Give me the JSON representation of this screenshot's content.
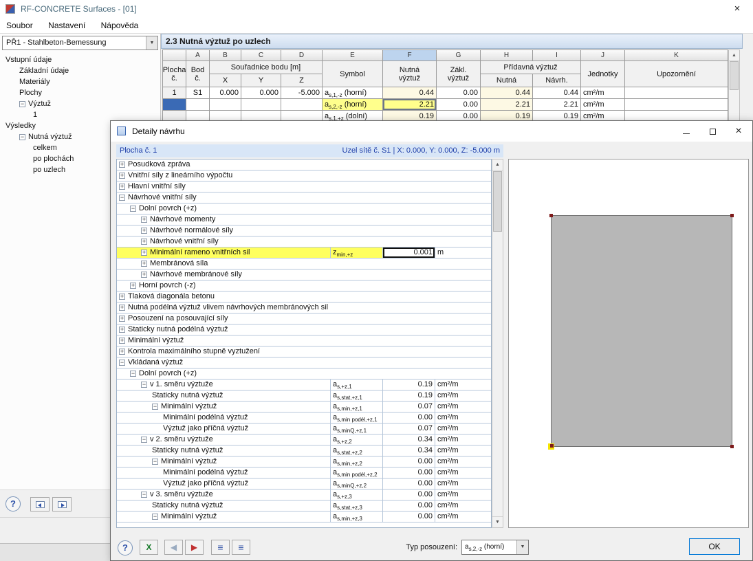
{
  "window": {
    "title": "RF-CONCRETE Surfaces - [01]"
  },
  "icons": {
    "close": "×",
    "help": "?",
    "excel": "X",
    "prev": "◀",
    "next": "▶",
    "list1": "≡",
    "list2": "≡",
    "up": "▲",
    "down": "▼",
    "dropdown": "▼"
  },
  "menu": {
    "items": [
      "Soubor",
      "Nastavení",
      "Nápověda"
    ]
  },
  "navigator": {
    "case_name": "PŘ1 - Stahlbeton-Bemessung",
    "items": [
      {
        "label": "Vstupní údaje",
        "indent": 0,
        "box": ""
      },
      {
        "label": "Základní údaje",
        "indent": 1,
        "box": ""
      },
      {
        "label": "Materiály",
        "indent": 1,
        "box": ""
      },
      {
        "label": "Plochy",
        "indent": 1,
        "box": ""
      },
      {
        "label": "Výztuž",
        "indent": 1,
        "box": "-"
      },
      {
        "label": "1",
        "indent": 2,
        "box": ""
      },
      {
        "label": "Výsledky",
        "indent": 0,
        "box": ""
      },
      {
        "label": "Nutná výztuž",
        "indent": 1,
        "box": "-"
      },
      {
        "label": "celkem",
        "indent": 2,
        "box": ""
      },
      {
        "label": "po plochách",
        "indent": 2,
        "box": ""
      },
      {
        "label": "po uzlech",
        "indent": 2,
        "box": ""
      }
    ]
  },
  "main": {
    "section_title": "2.3 Nutná výztuž po uzlech",
    "table": {
      "letters": [
        "",
        "A",
        "B",
        "C",
        "D",
        "E",
        "F",
        "G",
        "H",
        "I",
        "J",
        "K"
      ],
      "selected_letter": "F",
      "headers": {
        "plocha": "Plocha\nč.",
        "bod": "Bod\nč.",
        "coords": "Souřadnice bodu [m]",
        "x": "X",
        "y": "Y",
        "z": "Z",
        "symbol": "Symbol",
        "nutna": "Nutná\nvýztuž",
        "zakl": "Zákl.\nvýztuž",
        "pridavna": "Přídavná výztuž",
        "prid_nutna": "Nutná",
        "prid_navrh": "Návrh.",
        "jednotky": "Jednotky",
        "upozorneni": "Upozornění"
      },
      "rows": [
        {
          "plocha": "1",
          "bod": "S1",
          "x": "0.000",
          "y": "0.000",
          "z": "-5.000",
          "sym": {
            "b": "a",
            "s": "s,1,-z",
            "t": " (horní)"
          },
          "f": "0.44",
          "g": "0.00",
          "h": "0.44",
          "i": "0.44",
          "unit": "cm²/m",
          "note": "",
          "hl": false,
          "sel": false
        },
        {
          "plocha": "",
          "bod": "",
          "x": "",
          "y": "",
          "z": "",
          "sym": {
            "b": "a",
            "s": "s,2,-z",
            "t": " (horní)"
          },
          "f": "2.21",
          "g": "0.00",
          "h": "2.21",
          "i": "2.21",
          "unit": "cm²/m",
          "note": "",
          "hl": true,
          "sel": true
        },
        {
          "plocha": "",
          "bod": "",
          "x": "",
          "y": "",
          "z": "",
          "sym": {
            "b": "a",
            "s": "s,1,+z",
            "t": " (dolní)"
          },
          "f": "0.19",
          "g": "0.00",
          "h": "0.19",
          "i": "0.19",
          "unit": "cm²/m",
          "note": "",
          "hl": false,
          "sel": false
        }
      ]
    }
  },
  "dialog": {
    "title": "Detaily návrhu",
    "surface_label": "Plocha č. 1",
    "node_label": "Uzel sítě č. S1  |  X: 0.000, Y: 0.000, Z: -5.000 m",
    "tree": [
      {
        "label": "Posudková zpráva",
        "indent": 0,
        "box": "+"
      },
      {
        "label": "Vnitřní síly z lineárního výpočtu",
        "indent": 0,
        "box": "+"
      },
      {
        "label": "Hlavní vnitřní síly",
        "indent": 0,
        "box": "+"
      },
      {
        "label": "Návrhové vnitřní síly",
        "indent": 0,
        "box": "-"
      },
      {
        "label": "Dolní povrch (+z)",
        "indent": 1,
        "box": "-"
      },
      {
        "label": "Návrhové momenty",
        "indent": 2,
        "box": "+"
      },
      {
        "label": "Návrhové normálové síly",
        "indent": 2,
        "box": "+"
      },
      {
        "label": "Návrhové vnitřní síly",
        "indent": 2,
        "box": "+"
      },
      {
        "label": "Minimální rameno vnitřních sil",
        "indent": 2,
        "box": "+",
        "hl": true,
        "sym": {
          "b": "z",
          "s": "min,+z"
        },
        "val": "0.001",
        "unit": "m",
        "valbox": true
      },
      {
        "label": "Membránová síla",
        "indent": 2,
        "box": "+"
      },
      {
        "label": "Návrhové membránové síly",
        "indent": 2,
        "box": "+"
      },
      {
        "label": "Horní povrch (-z)",
        "indent": 1,
        "box": "+"
      },
      {
        "label": "Tlaková diagonála betonu",
        "indent": 0,
        "box": "+"
      },
      {
        "label": "Nutná podélná výztuž vlivem návrhových membránových sil",
        "indent": 0,
        "box": "+"
      },
      {
        "label": "Posouzení na posouvající síly",
        "indent": 0,
        "box": "+"
      },
      {
        "label": "Staticky nutná podélná výztuž",
        "indent": 0,
        "box": "+"
      },
      {
        "label": "Minimální výztuž",
        "indent": 0,
        "box": "+"
      },
      {
        "label": "Kontrola maximálního stupně vyztužení",
        "indent": 0,
        "box": "+"
      },
      {
        "label": "Vkládaná výztuž",
        "indent": 0,
        "box": "-"
      },
      {
        "label": "Dolní povrch (+z)",
        "indent": 1,
        "box": "-"
      },
      {
        "label": "v 1. směru výztuže",
        "indent": 2,
        "box": "-",
        "sym": {
          "b": "a",
          "s": "s,+z,1"
        },
        "val": "0.19",
        "unit": "cm²/m"
      },
      {
        "label": "Staticky nutná výztuž",
        "indent": 3,
        "box": "",
        "sym": {
          "b": "a",
          "s": "s,stat,+z,1"
        },
        "val": "0.19",
        "unit": "cm²/m"
      },
      {
        "label": "Minimální výztuž",
        "indent": 3,
        "box": "-",
        "sym": {
          "b": "a",
          "s": "s,min,+z,1"
        },
        "val": "0.07",
        "unit": "cm²/m"
      },
      {
        "label": "Minimální podélná výztuž",
        "indent": 4,
        "box": "",
        "sym": {
          "b": "a",
          "s": "s,min podél,+z,1"
        },
        "val": "0.00",
        "unit": "cm²/m"
      },
      {
        "label": "Výztuž jako příčná výztuž",
        "indent": 4,
        "box": "",
        "sym": {
          "b": "a",
          "s": "s,minQ,+z,1"
        },
        "val": "0.07",
        "unit": "cm²/m"
      },
      {
        "label": "v 2. směru výztuže",
        "indent": 2,
        "box": "-",
        "sym": {
          "b": "a",
          "s": "s,+z,2"
        },
        "val": "0.34",
        "unit": "cm²/m"
      },
      {
        "label": "Staticky nutná výztuž",
        "indent": 3,
        "box": "",
        "sym": {
          "b": "a",
          "s": "s,stat,+z,2"
        },
        "val": "0.34",
        "unit": "cm²/m"
      },
      {
        "label": "Minimální výztuž",
        "indent": 3,
        "box": "-",
        "sym": {
          "b": "a",
          "s": "s,min,+z,2"
        },
        "val": "0.00",
        "unit": "cm²/m"
      },
      {
        "label": "Minimální podélná výztuž",
        "indent": 4,
        "box": "",
        "sym": {
          "b": "a",
          "s": "s,min podél,+z,2"
        },
        "val": "0.00",
        "unit": "cm²/m"
      },
      {
        "label": "Výztuž jako příčná výztuž",
        "indent": 4,
        "box": "",
        "sym": {
          "b": "a",
          "s": "s,minQ,+z,2"
        },
        "val": "0.00",
        "unit": "cm²/m"
      },
      {
        "label": "v 3. směru výztuže",
        "indent": 2,
        "box": "-",
        "sym": {
          "b": "a",
          "s": "s,+z,3"
        },
        "val": "0.00",
        "unit": "cm²/m"
      },
      {
        "label": "Staticky nutná výztuž",
        "indent": 3,
        "box": "",
        "sym": {
          "b": "a",
          "s": "s,stat,+z,3"
        },
        "val": "0.00",
        "unit": "cm²/m"
      },
      {
        "label": "Minimální výztuž",
        "indent": 3,
        "box": "-",
        "sym": {
          "b": "a",
          "s": "s,min,+z,3"
        },
        "val": "0.00",
        "unit": "cm²/m"
      }
    ],
    "footer": {
      "type_label": "Typ posouzení:",
      "type_value": {
        "b": "a",
        "s": "s,2,-z",
        "t": " (horní)"
      },
      "ok": "OK"
    }
  }
}
